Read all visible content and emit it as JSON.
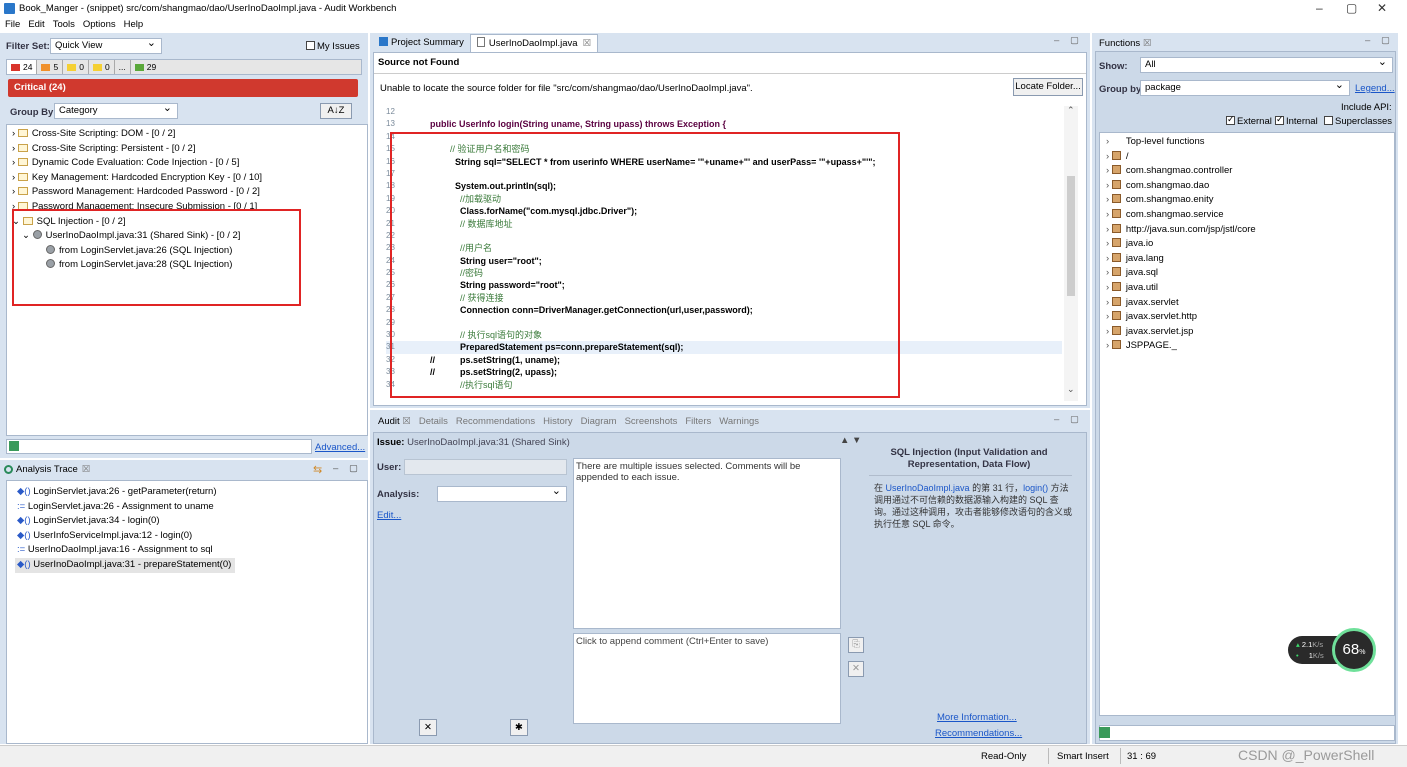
{
  "window": {
    "title": "Book_Manger - (snippet) src/com/shangmao/dao/UserInoDaoImpl.java - Audit Workbench",
    "controls": [
      "–",
      "▢",
      "✕"
    ]
  },
  "menu": [
    "File",
    "Edit",
    "Tools",
    "Options",
    "Help"
  ],
  "left_panel": {
    "filter_set_label": "Filter Set:",
    "filter_set_value": "Quick View",
    "my_issues_label": "My Issues",
    "severity_counts": [
      {
        "label": "24",
        "color": "#d9342b"
      },
      {
        "label": "5",
        "color": "#f0902a"
      },
      {
        "label": "0",
        "color": "#f5d033"
      },
      {
        "label": "0",
        "color": "#f5d033"
      },
      {
        "label": "...",
        "color": "#ffffff"
      },
      {
        "label": "29",
        "color": "#5aa83a"
      }
    ],
    "critical_label": "Critical (24)",
    "group_by_label": "Group By:",
    "group_by_value": "Category",
    "sort_label": "A↓Z",
    "categories": [
      "Cross-Site Scripting: DOM - [0 / 2]",
      "Cross-Site Scripting: Persistent - [0 / 2]",
      "Dynamic Code Evaluation: Code Injection - [0 / 5]",
      "Key Management: Hardcoded Encryption Key - [0 / 10]",
      "Password Management: Hardcoded Password - [0 / 2]",
      "Password Management: Insecure Submission - [0 / 1]",
      "SQL Injection - [0 / 2]"
    ],
    "sql_sink": "UserInoDaoImpl.java:31 (Shared Sink) - [0 / 2]",
    "sql_sources": [
      "from LoginServlet.java:26 (SQL Injection)",
      "from LoginServlet.java:28 (SQL Injection)"
    ],
    "search_placeholder": "",
    "advanced_link": "Advanced..."
  },
  "analysis_trace": {
    "tab_label": "Analysis Trace",
    "items": [
      {
        "icon": "◆()",
        "text": "LoginServlet.java:26 - getParameter(return)"
      },
      {
        "icon": ":=",
        "text": "LoginServlet.java:26 - Assignment to uname"
      },
      {
        "icon": "◆()",
        "text": "LoginServlet.java:34 - login(0)"
      },
      {
        "icon": "◆()",
        "text": "UserInfoServiceImpl.java:12 - login(0)"
      },
      {
        "icon": ":=",
        "text": "UserInoDaoImpl.java:16 - Assignment to sql"
      },
      {
        "icon": "◆()",
        "text": "UserInoDaoImpl.java:31 - prepareStatement(0)"
      }
    ]
  },
  "editor": {
    "tabs": [
      "Project Summary",
      "UserInoDaoImpl.java"
    ],
    "source_not_found": "Source not Found",
    "message": "Unable to locate the source folder for file \"src/com/shangmao/dao/UserInoDaoImpl.java\".",
    "locate_button": "Locate Folder...",
    "lines": [
      {
        "n": "12",
        "code": ""
      },
      {
        "n": "13",
        "code": "public UserInfo login(String uname, String upass) throws Exception {"
      },
      {
        "n": "14",
        "code": ""
      },
      {
        "n": "15",
        "code": "        // 验证用户名和密码"
      },
      {
        "n": "16",
        "code": "          String sql=\"SELECT * from userinfo WHERE userName= '\"+uname+\"' and userPass= '\"+upass+\"'\";"
      },
      {
        "n": "17",
        "code": ""
      },
      {
        "n": "18",
        "code": "          System.out.println(sql);"
      },
      {
        "n": "19",
        "code": "            //加载驱动"
      },
      {
        "n": "20",
        "code": "            Class.forName(\"com.mysql.jdbc.Driver\");"
      },
      {
        "n": "21",
        "code": "            // 数据库地址"
      },
      {
        "n": "22",
        "code": ""
      },
      {
        "n": "23",
        "code": "            //用户名"
      },
      {
        "n": "24",
        "code": "            String user=\"root\";"
      },
      {
        "n": "25",
        "code": "            //密码"
      },
      {
        "n": "26",
        "code": "            String password=\"root\";"
      },
      {
        "n": "27",
        "code": "            // 获得连接"
      },
      {
        "n": "28",
        "code": "            Connection conn=DriverManager.getConnection(url,user,password);"
      },
      {
        "n": "29",
        "code": ""
      },
      {
        "n": "30",
        "code": "            // 执行sql语句的对象"
      },
      {
        "n": "31",
        "code": "            PreparedStatement ps=conn.prepareStatement(sql);"
      },
      {
        "n": "32",
        "code": "//          ps.setString(1, uname);"
      },
      {
        "n": "33",
        "code": "//          ps.setString(2, upass);"
      },
      {
        "n": "34",
        "code": "            //执行sql语句"
      }
    ]
  },
  "audit": {
    "tabs": [
      "Audit",
      "Details",
      "Recommendations",
      "History",
      "Diagram",
      "Screenshots",
      "Filters",
      "Warnings"
    ],
    "issue_label": "Issue:",
    "issue_value": "UserInoDaoImpl.java:31 (Shared Sink)",
    "user_label": "User:",
    "analysis_label": "Analysis:",
    "edit_link": "Edit...",
    "comment_text": "There are multiple issues selected.  Comments will be appended to each issue.",
    "append_placeholder": "Click to append comment (Ctrl+Enter to save)",
    "description_title": "SQL Injection (Input Validation and Representation, Data Flow)",
    "description_link": "UserInoDaoImpl.java",
    "description_func": "login()",
    "description_pre": "在 ",
    "description_mid1": " 的第 31 行，",
    "description_mid2": " 方法调用通过不可信赖的数据源输入构建的 SQL 查询。通过这种调用，攻击者能够修改语句的含义或执行任意 SQL 命令。",
    "more_info": "More Information...",
    "recommendations": "Recommendations..."
  },
  "functions": {
    "tab_label": "Functions",
    "show_label": "Show:",
    "show_value": "All",
    "group_by_label": "Group by:",
    "group_by_value": "package",
    "legend_link": "Legend...",
    "include_api": "Include API:",
    "external": "External",
    "internal": "Internal",
    "superclasses": "Superclasses",
    "tree": [
      "Top-level functions",
      "/",
      "com.shangmao.controller",
      "com.shangmao.dao",
      "com.shangmao.enity",
      "com.shangmao.service",
      "http://java.sun.com/jsp/jstl/core",
      "java.io",
      "java.lang",
      "java.sql",
      "java.util",
      "javax.servlet",
      "javax.servlet.http",
      "javax.servlet.jsp",
      "JSPPAGE._"
    ]
  },
  "statusbar": {
    "mode": "Read-Only",
    "insert": "Smart Insert",
    "position": "31 : 69",
    "watermark": "CSDN @_PowerShell"
  },
  "widget": {
    "up": "2.1",
    "up_unit": "K/s",
    "down": "1",
    "down_unit": "K/s",
    "percent": "68",
    "percent_unit": "%"
  }
}
